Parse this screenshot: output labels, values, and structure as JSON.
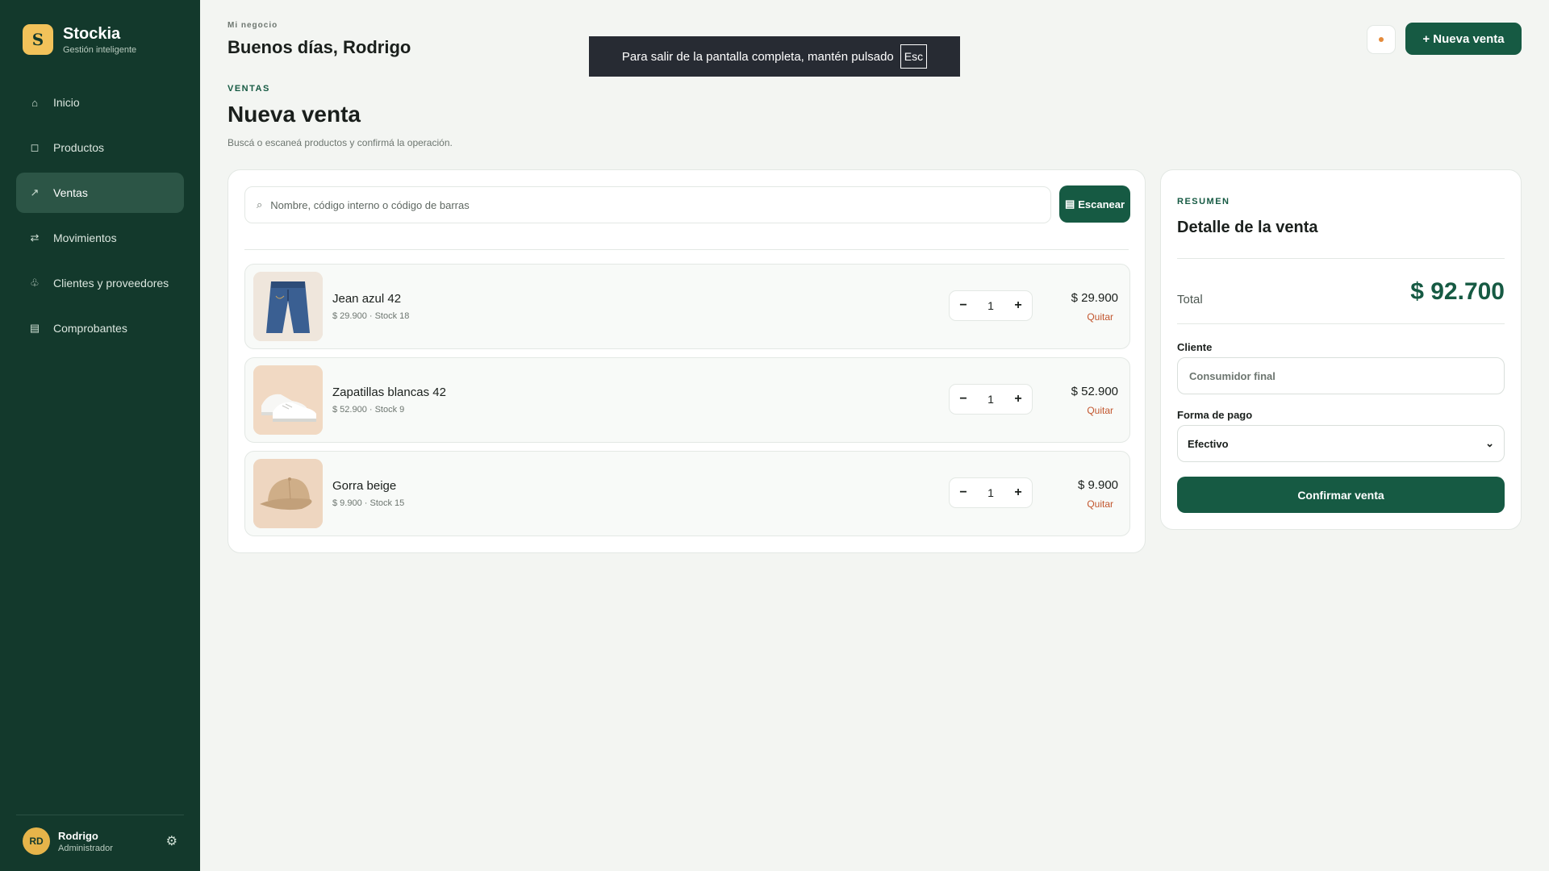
{
  "brand": {
    "logo_letter": "S",
    "name": "Stockia",
    "tagline": "Gestión inteligente"
  },
  "nav": {
    "items": [
      {
        "label": "Inicio",
        "icon": "home-icon",
        "glyph": "⌂",
        "active": false
      },
      {
        "label": "Productos",
        "icon": "box-icon",
        "glyph": "◻",
        "active": false
      },
      {
        "label": "Ventas",
        "icon": "trend-arrow-icon",
        "glyph": "↗",
        "active": true
      },
      {
        "label": "Movimientos",
        "icon": "swap-arrows-icon",
        "glyph": "⇄",
        "active": false
      },
      {
        "label": "Clientes y proveedores",
        "icon": "clover-icon",
        "glyph": "♧",
        "active": false
      },
      {
        "label": "Comprobantes",
        "icon": "receipt-icon",
        "glyph": "▤",
        "active": false
      }
    ]
  },
  "user": {
    "initials": "RD",
    "name": "Rodrigo",
    "role": "Administrador"
  },
  "header": {
    "eyebrow": "Mi negocio",
    "greeting": "Buenos días, Rodrigo",
    "new_sale_label": "+ Nueva venta"
  },
  "fullscreen_toast": {
    "text": "Para salir de la pantalla completa, mantén pulsado",
    "key": "Esc"
  },
  "page": {
    "section": "VENTAS",
    "title": "Nueva venta",
    "subtitle": "Buscá o escaneá productos y confirmá la operación."
  },
  "search": {
    "placeholder": "Nombre, código interno o código de barras",
    "value": "",
    "scan_label": "Escanear"
  },
  "cart": {
    "items": [
      {
        "name": "Jean azul 42",
        "meta": "$ 29.900 · Stock 18",
        "qty": "1",
        "price": "$ 29.900",
        "remove": "Quitar"
      },
      {
        "name": "Zapatillas blancas 42",
        "meta": "$ 52.900 · Stock 9",
        "qty": "1",
        "price": "$ 52.900",
        "remove": "Quitar"
      },
      {
        "name": "Gorra beige",
        "meta": "$ 9.900 · Stock 15",
        "qty": "1",
        "price": "$ 9.900",
        "remove": "Quitar"
      }
    ]
  },
  "summary": {
    "eyebrow": "RESUMEN",
    "title": "Detalle de la venta",
    "total_label": "Total",
    "total_value": "$ 92.700",
    "client_label": "Cliente",
    "client_placeholder": "Consumidor final",
    "payment_label": "Forma de pago",
    "payment_selected": "Efectivo",
    "confirm_label": "Confirmar venta"
  },
  "colors": {
    "sidebar": "#13392c",
    "primary": "#165a43",
    "accent": "#f2c25a",
    "danger": "#c2562e",
    "background": "#f3f5f2"
  }
}
